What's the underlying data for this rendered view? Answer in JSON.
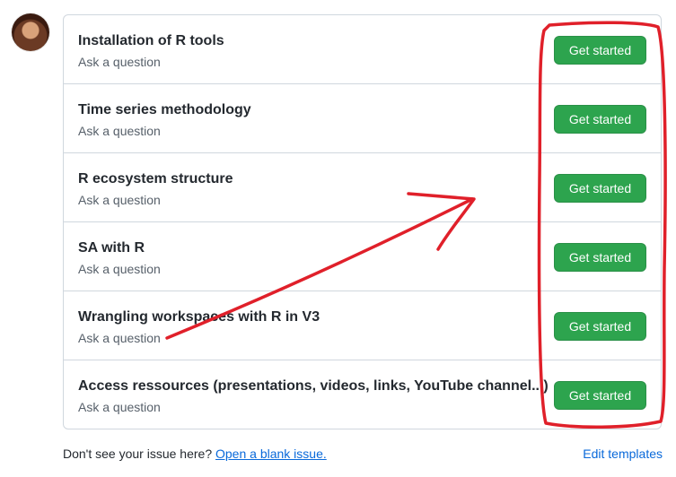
{
  "templates": [
    {
      "title": "Installation of R tools",
      "subtitle": "Ask a question",
      "button": "Get started"
    },
    {
      "title": "Time series methodology",
      "subtitle": "Ask a question",
      "button": "Get started"
    },
    {
      "title": "R ecosystem structure",
      "subtitle": "Ask a question",
      "button": "Get started"
    },
    {
      "title": "SA with R",
      "subtitle": "Ask a question",
      "button": "Get started"
    },
    {
      "title": "Wrangling workspaces with R in V3",
      "subtitle": "Ask a question",
      "button": "Get started"
    },
    {
      "title": "Access ressources (presentations, videos, links, YouTube channel...)",
      "subtitle": "Ask a question",
      "button": "Get started"
    }
  ],
  "footer": {
    "prompt": "Don't see your issue here?",
    "blank_issue_link": "Open a blank issue.",
    "edit_templates": "Edit templates"
  },
  "colors": {
    "button_green": "#2da44e",
    "link_blue": "#0969da",
    "annotation_red": "#e0202a"
  }
}
